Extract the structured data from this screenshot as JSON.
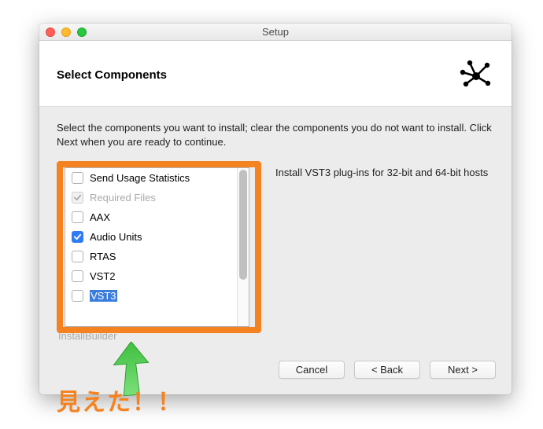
{
  "window": {
    "title": "Setup"
  },
  "header": {
    "title": "Select Components"
  },
  "instructions": "Select the components you want to install; clear the components you do not want to install. Click Next when you are ready to continue.",
  "components": [
    {
      "label": "Send Usage Statistics",
      "checked": false,
      "disabled": false,
      "selected": false
    },
    {
      "label": "Required Files",
      "checked": true,
      "disabled": true,
      "selected": false
    },
    {
      "label": "AAX",
      "checked": false,
      "disabled": false,
      "selected": false
    },
    {
      "label": "Audio Units",
      "checked": true,
      "disabled": false,
      "selected": false
    },
    {
      "label": "RTAS",
      "checked": false,
      "disabled": false,
      "selected": false
    },
    {
      "label": "VST2",
      "checked": false,
      "disabled": false,
      "selected": false
    },
    {
      "label": "VST3",
      "checked": false,
      "disabled": false,
      "selected": true
    }
  ],
  "description": "Install VST3 plug-ins for 32-bit and 64-bit hosts",
  "installbuilder": "InstallBuilder",
  "buttons": {
    "cancel": "Cancel",
    "back": "< Back",
    "next": "Next >"
  },
  "annotation": {
    "caption": "見えた！！"
  }
}
